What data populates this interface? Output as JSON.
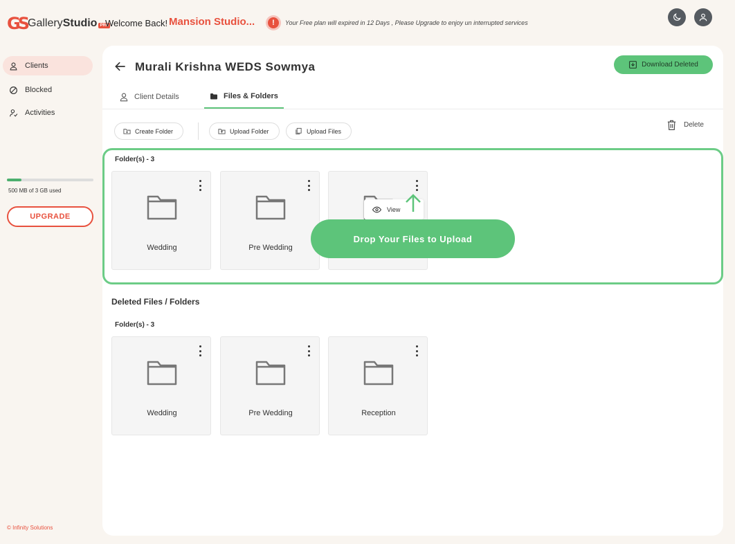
{
  "header": {
    "logo_text_light": "Gallery",
    "logo_text_bold": "Studio",
    "logo_badge": "PRO",
    "welcome": "Welcome Back!",
    "studio_name": "Mansion Studio...",
    "plan_message": "Your Free plan will expired in 12 Days , Please Upgrade to enjoy un interrupted services"
  },
  "sidebar": {
    "items": [
      {
        "label": "Clients",
        "icon": "user-icon"
      },
      {
        "label": "Blocked",
        "icon": "block-icon"
      },
      {
        "label": "Activities",
        "icon": "activity-icon"
      }
    ],
    "storage_text": "500 MB of 3 GB used",
    "storage_fraction": 0.17,
    "upgrade_label": "UPGRADE",
    "copyright": "© Infinity Solutions"
  },
  "main": {
    "title": "Murali Krishna WEDS Sowmya",
    "download_deleted_label": "Download Deleted",
    "tabs": [
      {
        "label": "Client Details"
      },
      {
        "label": "Files & Folders"
      }
    ],
    "toolbar": {
      "create_folder": "Create Folder",
      "upload_folder": "Upload Folder",
      "upload_files": "Upload Files",
      "delete": "Delete"
    },
    "folders_label": "Folder(s) - 3",
    "folders": [
      {
        "name": "Wedding"
      },
      {
        "name": "Pre Wedding"
      },
      {
        "name": ""
      }
    ],
    "view_label": "View",
    "drop_label": "Drop Your Files to Upload",
    "deleted_title": "Deleted Files / Folders",
    "deleted_folders_label": "Folder(s) - 3",
    "deleted_folders": [
      {
        "name": "Wedding"
      },
      {
        "name": "Pre Wedding"
      },
      {
        "name": "Reception"
      }
    ]
  },
  "colors": {
    "accent_red": "#e8513e",
    "accent_green": "#5dc47a"
  }
}
